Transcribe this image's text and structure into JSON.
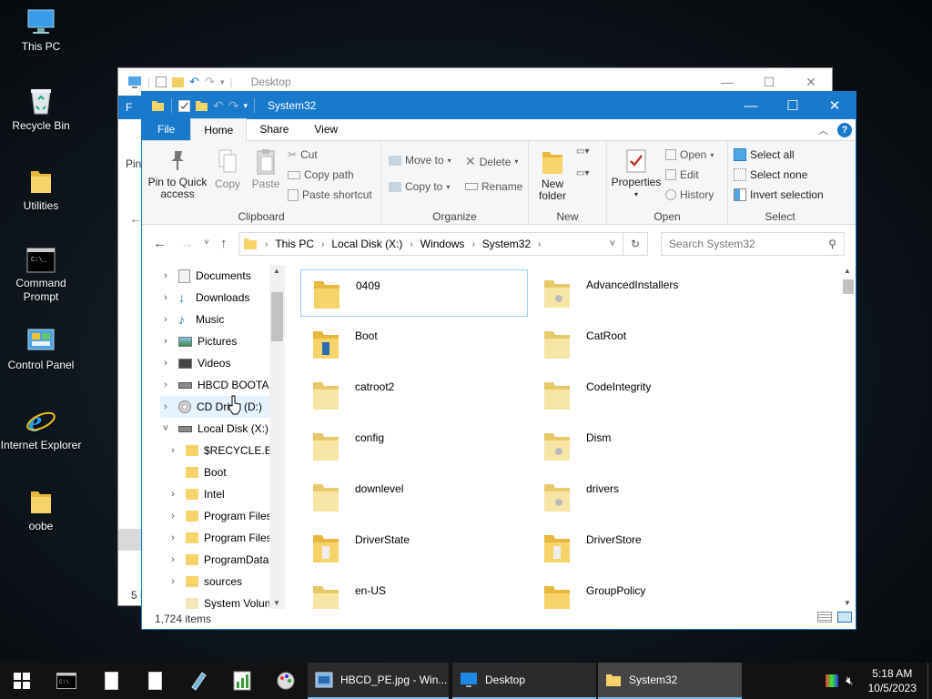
{
  "desktop": {
    "icons": [
      {
        "label": "This PC",
        "icon": "this-pc-icon"
      },
      {
        "label": "Recycle Bin",
        "icon": "recycle-bin-icon"
      },
      {
        "label": "Utilities",
        "icon": "folder-icon"
      },
      {
        "label": "Command Prompt",
        "icon": "cmd-icon"
      },
      {
        "label": "Control Panel",
        "icon": "control-panel-icon"
      },
      {
        "label": "Internet Explorer",
        "icon": "ie-icon"
      },
      {
        "label": "oobe",
        "icon": "folder-icon"
      }
    ]
  },
  "back_window": {
    "title": "Desktop",
    "partial_texts": [
      "F",
      "Pin",
      "5 i"
    ]
  },
  "window": {
    "title": "System32",
    "tabs": {
      "file": "File",
      "home": "Home",
      "share": "Share",
      "view": "View"
    },
    "ribbon": {
      "clipboard": {
        "label": "Clipboard",
        "pin": "Pin to Quick access",
        "copy": "Copy",
        "paste": "Paste",
        "cut": "Cut",
        "copy_path": "Copy path",
        "paste_shortcut": "Paste shortcut"
      },
      "organize": {
        "label": "Organize",
        "move_to": "Move to",
        "copy_to": "Copy to",
        "delete": "Delete",
        "rename": "Rename"
      },
      "new": {
        "label": "New",
        "new_folder": "New folder"
      },
      "open": {
        "label": "Open",
        "properties": "Properties",
        "open": "Open",
        "edit": "Edit",
        "history": "History"
      },
      "select": {
        "label": "Select",
        "select_all": "Select all",
        "select_none": "Select none",
        "invert": "Invert selection"
      }
    },
    "address": {
      "crumbs": [
        "This PC",
        "Local Disk (X:)",
        "Windows",
        "System32"
      ],
      "search_placeholder": "Search System32"
    },
    "nav": [
      {
        "label": "Documents",
        "icon": "documents-icon"
      },
      {
        "label": "Downloads",
        "icon": "downloads-icon"
      },
      {
        "label": "Music",
        "icon": "music-icon"
      },
      {
        "label": "Pictures",
        "icon": "pictures-icon"
      },
      {
        "label": "Videos",
        "icon": "videos-icon"
      },
      {
        "label": "HBCD BOOTAB",
        "icon": "drive-icon"
      },
      {
        "label": "CD Drive (D:)",
        "icon": "cd-drive-icon"
      },
      {
        "label": "Local Disk (X:)",
        "icon": "drive-icon"
      },
      {
        "label": "$RECYCLE.BIN",
        "icon": "folder-icon"
      },
      {
        "label": "Boot",
        "icon": "folder-icon"
      },
      {
        "label": "Intel",
        "icon": "folder-icon"
      },
      {
        "label": "Program Files",
        "icon": "folder-icon"
      },
      {
        "label": "Program Files",
        "icon": "folder-icon"
      },
      {
        "label": "ProgramData",
        "icon": "folder-icon"
      },
      {
        "label": "sources",
        "icon": "folder-icon"
      },
      {
        "label": "System Volun",
        "icon": "folder-icon"
      }
    ],
    "files": [
      "0409",
      "AdvancedInstallers",
      "Boot",
      "CatRoot",
      "catroot2",
      "CodeIntegrity",
      "config",
      "Dism",
      "downlevel",
      "drivers",
      "DriverState",
      "DriverStore",
      "en-US",
      "GroupPolicy"
    ],
    "status": "1,724 items"
  },
  "taskbar": {
    "apps": [
      {
        "label": "HBCD_PE.jpg - Win...",
        "icon": "image-viewer-icon"
      },
      {
        "label": "Desktop",
        "icon": "monitor-icon"
      },
      {
        "label": "System32",
        "icon": "folder-icon"
      }
    ],
    "time": "5:18 AM",
    "date": "10/5/2023"
  },
  "colors": {
    "accent": "#1979ca",
    "folder": "#f5c842",
    "taskbar": "#121212"
  }
}
